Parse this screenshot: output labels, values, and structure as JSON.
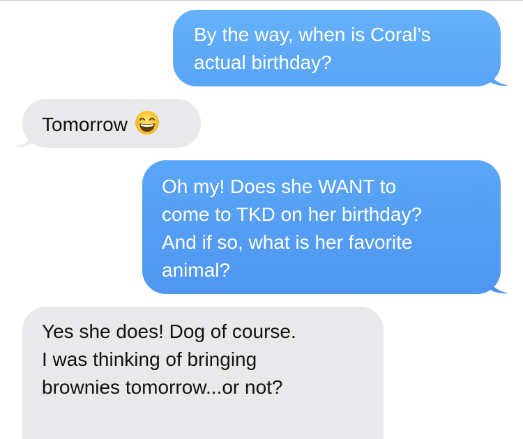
{
  "messages": [
    {
      "direction": "sent",
      "text": "By the way, when is Coral’s\nactual birthday?"
    },
    {
      "direction": "received",
      "text": "Tomorrow",
      "emoji": "grinning-face-with-smiling-eyes"
    },
    {
      "direction": "sent",
      "text": "Oh my! Does she WANT to\ncome to TKD on her birthday?\nAnd if so, what is her favorite\nanimal?"
    },
    {
      "direction": "received",
      "text": "Yes she does!  Dog of course.\nI was thinking of bringing\nbrownies tomorrow...or not?"
    }
  ],
  "colors": {
    "sent_bubble_top": "#66b1f9",
    "sent_bubble_bottom": "#4f96f0",
    "received_bubble": "#e9e9eb",
    "sent_text": "#ffffff",
    "received_text": "#111111",
    "background": "#ffffff"
  }
}
